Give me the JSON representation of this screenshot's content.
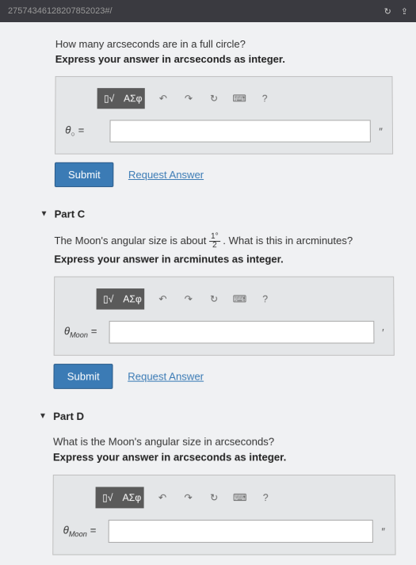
{
  "browser": {
    "url_fragment": "27574346128207852023#/"
  },
  "partB": {
    "question": "How many arcseconds are in a full circle?",
    "instruction": "Express your answer in arcseconds as integer.",
    "var_html": "θ<sub>○</sub> =",
    "unit": "″",
    "submit": "Submit",
    "request": "Request Answer"
  },
  "partC": {
    "title": "Part C",
    "question_prefix": "The Moon's angular size is about ",
    "frac_num": "1°",
    "frac_den": "2",
    "question_suffix": ". What is this in arcminutes?",
    "instruction": "Express your answer in arcminutes as integer.",
    "var_html": "θ<sub>Moon</sub> =",
    "unit": "′",
    "submit": "Submit",
    "request": "Request Answer"
  },
  "partD": {
    "title": "Part D",
    "question": "What is the Moon's angular size in arcseconds?",
    "instruction": "Express your answer in arcseconds as integer.",
    "var_html": "θ<sub>Moon</sub> =",
    "unit": "″"
  },
  "toolbar": {
    "template": "▯√",
    "greek": "ΑΣφ",
    "undo": "↶",
    "redo": "↷",
    "reset": "↻",
    "keyboard": "⌨",
    "help": "?"
  }
}
